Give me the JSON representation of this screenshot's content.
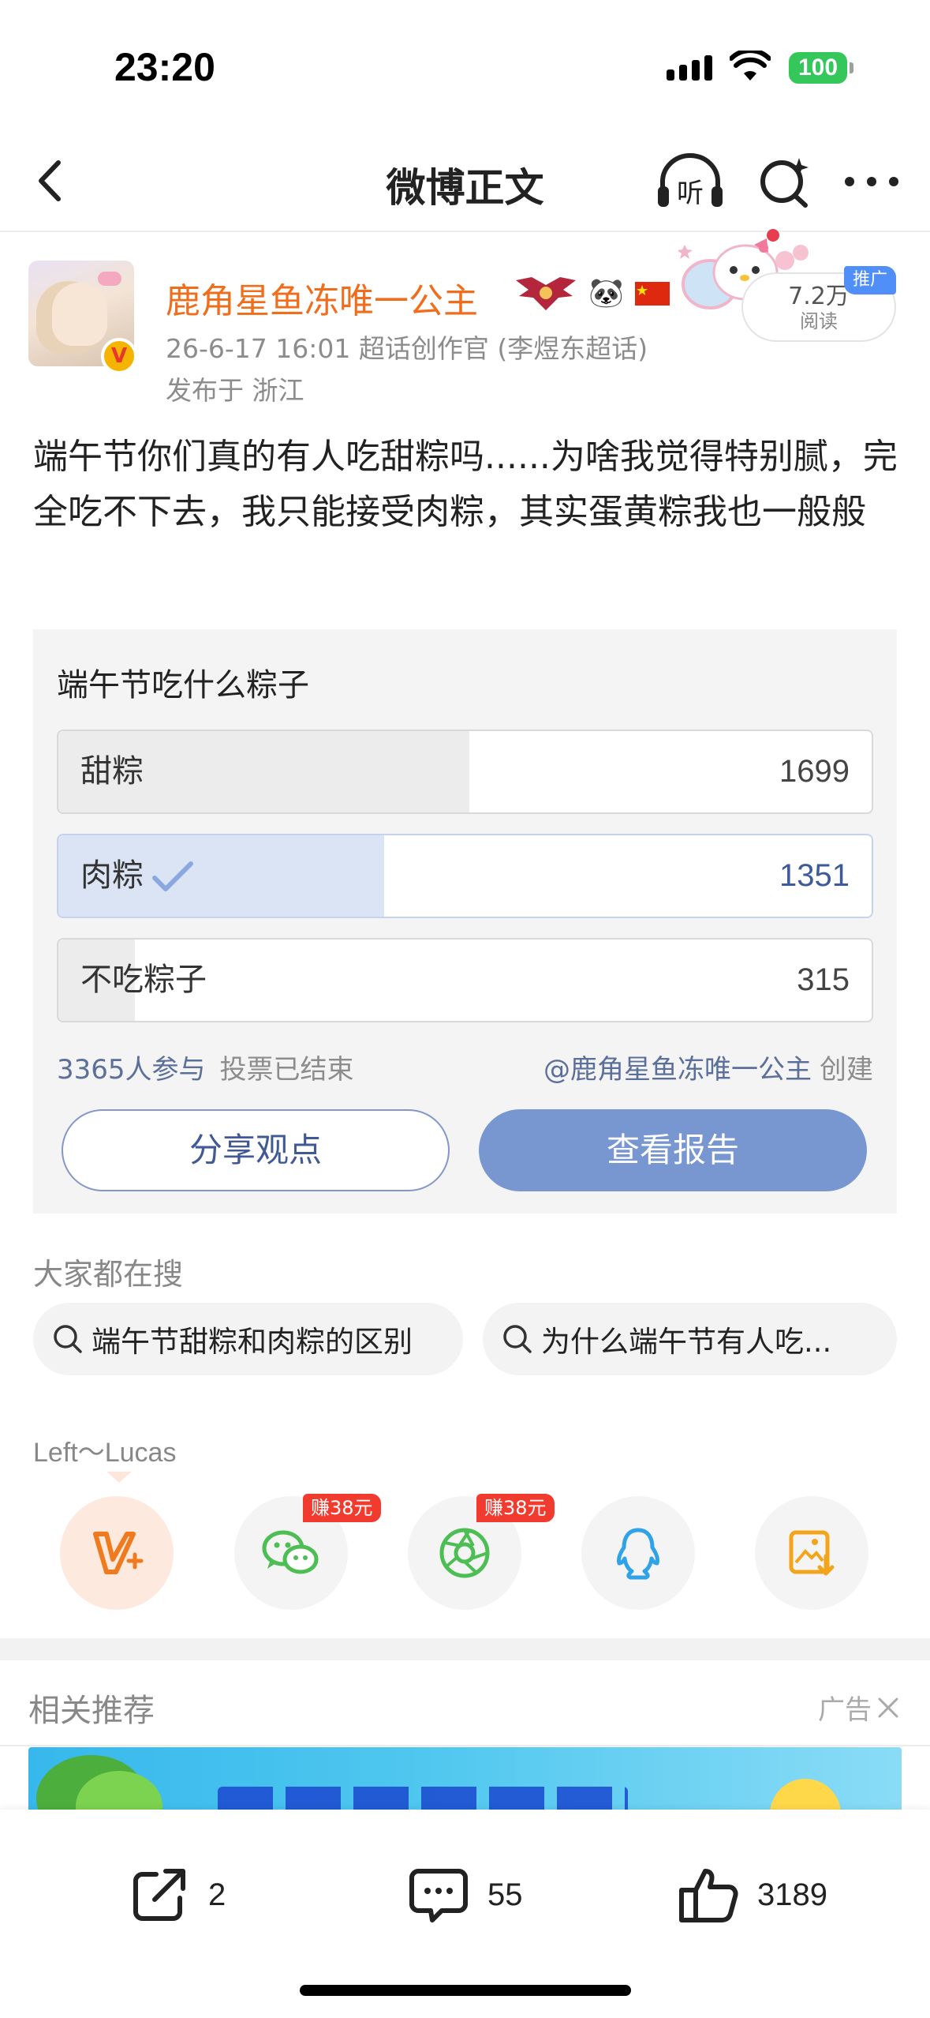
{
  "status_bar": {
    "time": "23:20",
    "battery": "100"
  },
  "nav": {
    "title": "微博正文",
    "listen_label": "听"
  },
  "post": {
    "author": "鹿角星鱼冻唯一公主",
    "verified_mark": "V",
    "meta": "26-6-17 16:01  超话创作官 (李煜东超话)",
    "location": "发布于 浙江",
    "read_count": "7.2万",
    "read_label": "阅读",
    "promo_tag": "推广",
    "text": "端午节你们真的有人吃甜粽吗......为啥我觉得特别腻，完全吃不下去，我只能接受肉粽，其实蛋黄粽我也一般般"
  },
  "poll": {
    "title": "端午节吃什么粽子",
    "options": [
      {
        "label": "甜粽",
        "count": "1699",
        "fraction": 0.505,
        "selected": false
      },
      {
        "label": "肉粽",
        "count": "1351",
        "fraction": 0.401,
        "selected": true
      },
      {
        "label": "不吃粽子",
        "count": "315",
        "fraction": 0.094,
        "selected": false
      }
    ],
    "participants": "3365人参与",
    "status": "投票已结束",
    "creator": "@鹿角星鱼冻唯一公主",
    "created_label": "创建",
    "share_button": "分享观点",
    "report_button": "查看报告"
  },
  "hot_search": {
    "title": "大家都在搜",
    "items": [
      "端午节甜粽和肉粽的区别",
      "为什么端午节有人吃..."
    ]
  },
  "share": {
    "title": "Left～Lucas",
    "earn_wechat": "赚38元",
    "earn_moments": "赚38元",
    "targets": [
      "weibo-icon",
      "wechat-icon",
      "moments-icon",
      "qq-icon",
      "save-image-icon"
    ]
  },
  "recommend": {
    "title": "相关推荐",
    "ad_label": "广告"
  },
  "actions": {
    "repost_count": "2",
    "comment_count": "55",
    "like_count": "3189"
  },
  "colors": {
    "author_orange": "#f06e1b",
    "link_blue": "#5a6f9a",
    "report_button": "#7897d0",
    "selected_fill": "#dbe4f5",
    "earn_red": "#f23b2f",
    "battery_green": "#35c759"
  }
}
